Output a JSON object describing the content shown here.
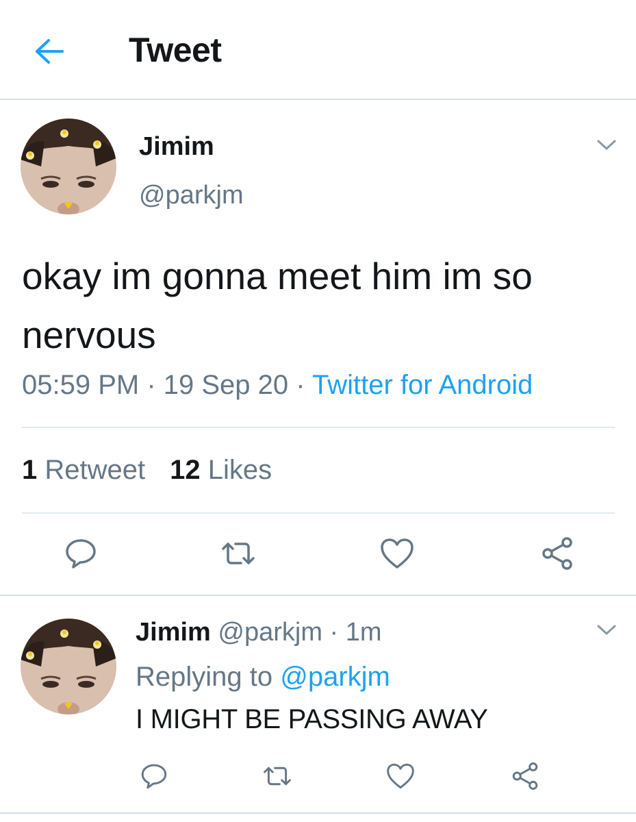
{
  "header": {
    "title": "Tweet",
    "back_icon": "arrow-left-icon"
  },
  "colors": {
    "accent": "#1da1f2",
    "text_primary": "#14171a",
    "text_secondary": "#657786",
    "divider": "#e1e8ed"
  },
  "main_tweet": {
    "author_name": "Jimim",
    "author_handle": "@parkjm",
    "text": "okay im gonna meet him im so nervous",
    "time": "05:59 PM",
    "date": "19 Sep 20",
    "separator": " · ",
    "source": "Twitter for Android",
    "retweet_count": "1",
    "retweet_label": "Retweet",
    "like_count": "12",
    "like_label": "Likes",
    "actions": [
      "reply-icon",
      "retweet-icon",
      "like-icon",
      "share-icon"
    ]
  },
  "reply": {
    "author_name": "Jimim",
    "author_handle": "@parkjm",
    "time_sep": " · ",
    "time_ago": "1m",
    "replying_prefix": "Replying to ",
    "replying_to": "@parkjm",
    "text": "I MIGHT BE PASSING AWAY",
    "actions": [
      "reply-icon",
      "retweet-icon",
      "like-icon",
      "share-icon"
    ]
  }
}
